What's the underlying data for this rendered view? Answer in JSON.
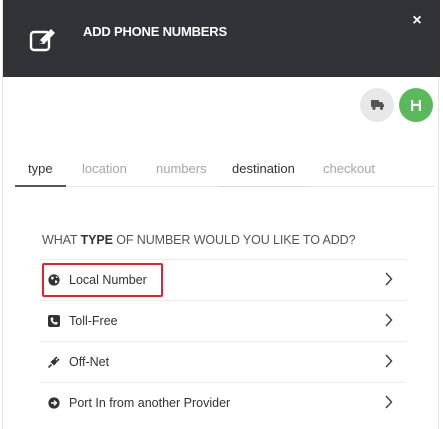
{
  "header": {
    "title": "ADD PHONE NUMBERS",
    "icon": "edit-icon",
    "close_icon": "close-icon",
    "background_color": "#313337"
  },
  "actions": {
    "truck_icon": "truck-icon",
    "save_icon": "save-icon",
    "save_color": "#5cb85c"
  },
  "tabs": [
    {
      "label": "type",
      "state": "active"
    },
    {
      "label": "location",
      "state": "inactive"
    },
    {
      "label": "numbers",
      "state": "inactive"
    },
    {
      "label": "destination",
      "state": "current"
    },
    {
      "label": "checkout",
      "state": "inactive"
    }
  ],
  "question": {
    "prefix": "WHAT ",
    "emphasis": "TYPE",
    "suffix": " OF NUMBER WOULD YOU LIKE TO ADD?"
  },
  "options": [
    {
      "label": "Local Number",
      "icon": "globe-icon",
      "highlighted": true
    },
    {
      "label": "Toll-Free",
      "icon": "phone-icon",
      "highlighted": false
    },
    {
      "label": "Off-Net",
      "icon": "plug-icon",
      "highlighted": false
    },
    {
      "label": "Port In from another Provider",
      "icon": "arrow-circle-icon",
      "highlighted": false
    }
  ],
  "highlight_color": "#d9282f"
}
